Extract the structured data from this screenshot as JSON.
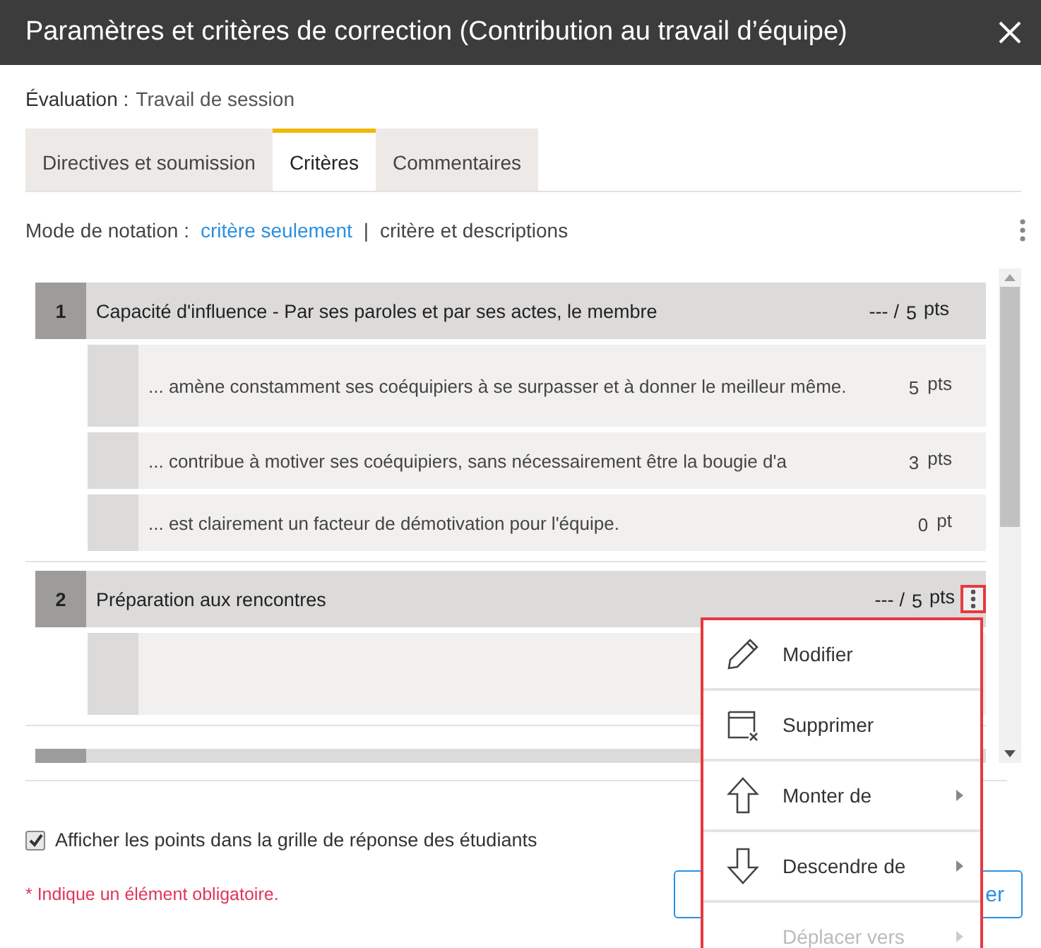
{
  "window": {
    "title": "Paramètres et critères de correction (Contribution au travail d’équipe)"
  },
  "evaluation": {
    "label": "Évaluation :",
    "value": "Travail de session"
  },
  "tabs": [
    {
      "label": "Directives et soumission",
      "selected": false
    },
    {
      "label": "Critères",
      "selected": true
    },
    {
      "label": "Commentaires",
      "selected": false
    }
  ],
  "grading_mode": {
    "label": "Mode de notation :",
    "separator": "|",
    "options": [
      {
        "label": "critère seulement",
        "selected": true
      },
      {
        "label": "critère et descriptions",
        "selected": false
      }
    ]
  },
  "criteria": [
    {
      "kind": "full",
      "number": "1",
      "title": "Capacité d'influence - Par ses paroles et par ses actes, le membre",
      "score": "---",
      "slash": "/",
      "max": "5",
      "unit": "pts",
      "menu_open": false,
      "levels": [
        {
          "kind": "text",
          "text": "... amène constamment ses coéquipiers à se surpasser et à donner le meilleur même.",
          "points": "5",
          "unit": "pts"
        },
        {
          "kind": "text",
          "text": "... contribue à motiver ses coéquipiers, sans nécessairement être la bougie d'a",
          "points": "3",
          "unit": "pts"
        },
        {
          "kind": "text",
          "text": "... est clairement un facteur de démotivation pour l'équipe.",
          "points": "0",
          "unit": "pt"
        }
      ]
    },
    {
      "kind": "full",
      "number": "2",
      "title": "Préparation aux rencontres",
      "score": "---",
      "slash": "/",
      "max": "5",
      "unit": "pts",
      "menu_open": true,
      "levels": [
        {
          "kind": "blank"
        }
      ]
    },
    {
      "kind": "cut"
    }
  ],
  "menu": [
    {
      "kind": "edit",
      "label": "Modifier",
      "submenu": false,
      "disabled": false
    },
    {
      "kind": "delete",
      "label": "Supprimer",
      "submenu": false,
      "disabled": false
    },
    {
      "kind": "up",
      "label": "Monter de",
      "submenu": true,
      "disabled": false
    },
    {
      "kind": "down",
      "label": "Descendre de",
      "submenu": true,
      "disabled": false
    },
    {
      "kind": "move",
      "label": "Déplacer vers",
      "submenu": true,
      "disabled": true
    }
  ],
  "show_points": {
    "label": "Afficher les points dans la grille de réponse des étudiants",
    "checked": true
  },
  "required_note": "* Indique un élément obligatoire.",
  "button": {
    "label": "er"
  }
}
